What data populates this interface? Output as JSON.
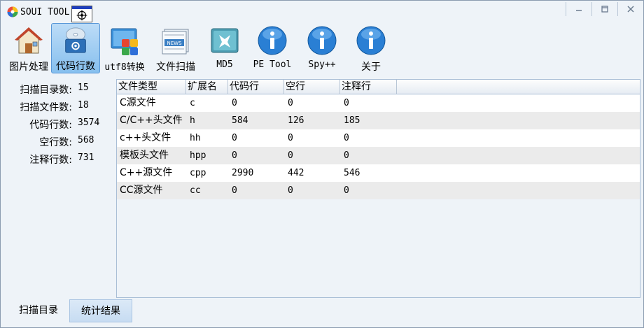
{
  "window": {
    "title": "SOUI TOOL"
  },
  "title_controls": [
    "minimize-icon",
    "maximize-icon",
    "close-icon"
  ],
  "toolbar": {
    "items": [
      {
        "label": "图片处理",
        "icon": "house-icon",
        "active": false
      },
      {
        "label": "代码行数",
        "icon": "disc-gear-icon",
        "active": true
      },
      {
        "label": "utf8转换",
        "icon": "colored-blocks-icon",
        "active": false
      },
      {
        "label": "文件扫描",
        "icon": "news-icon",
        "active": false
      },
      {
        "label": "MD5",
        "icon": "md5-icon",
        "active": false
      },
      {
        "label": "PE Tool",
        "icon": "info-icon",
        "active": false
      },
      {
        "label": "Spy++",
        "icon": "info-icon",
        "active": false
      },
      {
        "label": "关于",
        "icon": "info-icon",
        "active": false
      }
    ]
  },
  "stats": [
    {
      "label": "扫描目录数:",
      "value": "15"
    },
    {
      "label": "扫描文件数:",
      "value": "18"
    },
    {
      "label": "代码行数:",
      "value": "3574"
    },
    {
      "label": "空行数:",
      "value": "568"
    },
    {
      "label": "注释行数:",
      "value": "731"
    }
  ],
  "table": {
    "columns": [
      "文件类型",
      "扩展名",
      "代码行",
      "空行",
      "注释行"
    ],
    "rows": [
      [
        "C源文件",
        "c",
        "0",
        "0",
        "0"
      ],
      [
        "C/C++头文件",
        "h",
        "584",
        "126",
        "185"
      ],
      [
        "c++头文件",
        "hh",
        "0",
        "0",
        "0"
      ],
      [
        "模板头文件",
        "hpp",
        "0",
        "0",
        "0"
      ],
      [
        "C++源文件",
        "cpp",
        "2990",
        "442",
        "546"
      ],
      [
        "CC源文件",
        "cc",
        "0",
        "0",
        "0"
      ]
    ]
  },
  "tabs": [
    {
      "label": "扫描目录",
      "active": false
    },
    {
      "label": "统计结果",
      "active": true
    }
  ],
  "colors": {
    "accent": "#86bfee",
    "background": "#eef3f8",
    "info_blue": "#2a7fd4"
  }
}
